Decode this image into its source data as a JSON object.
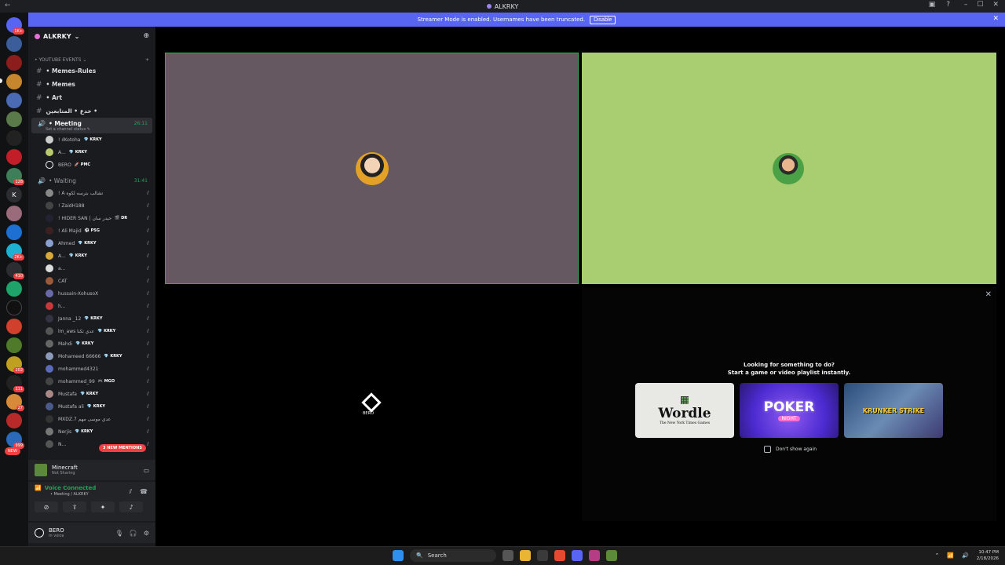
{
  "window": {
    "title": "ALKRKY"
  },
  "banner": {
    "text": "Streamer Mode is enabled. Usernames have been truncated.",
    "disable_label": "Disable"
  },
  "rail": {
    "badges": [
      "1K+",
      "128",
      "2K+",
      "410",
      "202",
      "111",
      "27",
      "999",
      "NEW"
    ],
    "letters": [
      "K"
    ]
  },
  "guild": {
    "name": "ALKRKY"
  },
  "category": {
    "label": "• YOUTUBE EVENTS ⌄"
  },
  "channels": [
    {
      "label": "• Memes-Rules"
    },
    {
      "label": "• Memes"
    },
    {
      "label": "• Art"
    },
    {
      "label": "خدع • المتابعين •"
    }
  ],
  "voice_meeting": {
    "label": "• Meeting",
    "time": "26:11",
    "status": "Set a channel status ✎"
  },
  "meeting_members": [
    {
      "name": "! ılKotoha",
      "tag": "💎 KRKY"
    },
    {
      "name": "A...",
      "tag": "💎 KRKY"
    },
    {
      "name": "BERO",
      "tag": "🚀 PMC"
    }
  ],
  "voice_waiting": {
    "label": "• Waiting",
    "time": "31:41"
  },
  "waiting_members": [
    {
      "name": "! A تشالب بترسه لكوه",
      "tag": ""
    },
    {
      "name": "! ZaidH188",
      "tag": ""
    },
    {
      "name": "! HIDER SAN | حيدر سان",
      "tag": "🎬 DR"
    },
    {
      "name": "! Ali Majid",
      "tag": "⚽ PSG"
    },
    {
      "name": "Ahmed",
      "tag": "💎 KRKY"
    },
    {
      "name": "A...",
      "tag": "💎 KRKY"
    },
    {
      "name": "a...",
      "tag": ""
    },
    {
      "name": "CAT",
      "tag": ""
    },
    {
      "name": "hussain-XohusoX",
      "tag": ""
    },
    {
      "name": "h...",
      "tag": ""
    },
    {
      "name": "Janna _12",
      "tag": "💎 KRKY"
    },
    {
      "name": "lm_aws عدي تكنا",
      "tag": "💎 KRKY"
    },
    {
      "name": "Mahdi",
      "tag": "💎 KRKY"
    },
    {
      "name": "Mohameed 66666",
      "tag": "💎 KRKY"
    },
    {
      "name": "mohammed4321",
      "tag": ""
    },
    {
      "name": "mohammed_99",
      "tag": "🎮 MGO"
    },
    {
      "name": "Mustafa",
      "tag": "💎 KRKY"
    },
    {
      "name": "Mustafa ali",
      "tag": "💎 KRKY"
    },
    {
      "name": "MXDZ.7 عدي موسى مهم",
      "tag": ""
    },
    {
      "name": "Nerjis",
      "tag": "💎 KRKY"
    },
    {
      "name": "N...",
      "tag": ""
    }
  ],
  "mentions": {
    "label": "3 NEW MENTIONS"
  },
  "activity": {
    "title": "Minecraft",
    "subtitle": "Not Sharing"
  },
  "voice": {
    "status": "Voice Connected",
    "channel": "• Meeting / ALKRKY"
  },
  "user": {
    "name": "BERO",
    "status": "In voice"
  },
  "stage": {
    "tile3_label": "BERO",
    "activities_line1": "Looking for something to do?",
    "activities_line2": "Start a game or video playlist instantly.",
    "cards": [
      {
        "title": "Wordle",
        "subtitle": "The New York Times Games"
      },
      {
        "title": "POKER",
        "subtitle": "NIGHT"
      },
      {
        "title": "KRUNKER STRIKE",
        "subtitle": ""
      }
    ],
    "dont_show": "Don't show again"
  },
  "taskbar": {
    "search": "Search",
    "time": "10:47 PM",
    "date": "2/18/2026"
  },
  "colors": {
    "accent": "#5865f2",
    "online": "#23a55a",
    "mention": "#f23f43",
    "tile1": "#655860",
    "tile2": "#a8ce71"
  }
}
